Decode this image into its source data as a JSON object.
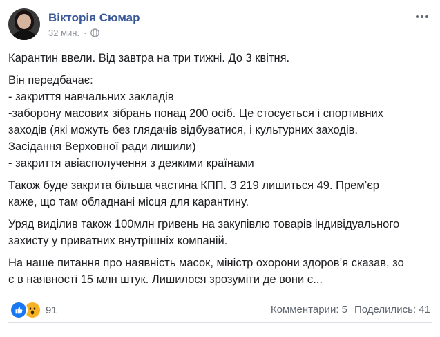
{
  "author": {
    "name": "Вікторія Сюмар",
    "time": "32 мин."
  },
  "icons": {
    "avatar": "avatar-photo",
    "privacy": "globe-icon",
    "more": "more-options-icon",
    "like": "like-reaction-icon",
    "wow": "wow-reaction-icon"
  },
  "post": {
    "paragraphs": [
      [
        "Карантин ввели. Від завтра на три тижні. До 3 квітня."
      ],
      [
        "Він передбачає:",
        "- закриття навчальних закладів",
        "-заборону масових зібрань понад 200 осіб. Це стосується і спортивних",
        "заходів (які можуть без глядачів відбуватися, і культурних заходів.",
        "Засідання Верховної ради лишили)",
        "- закриття авіасполучення з деякими країнами"
      ],
      [
        "Також буде закрита більша частина КПП. З 219 лишиться 49. Прем’єр",
        "каже, що там обладнані місця для карантину."
      ],
      [
        "Уряд виділив також 100млн гривень на закупівлю товарів індивідуального",
        "захисту у приватних внутрішніх компаній."
      ],
      [
        "На наше питання про наявність масок, міністр охорони здоров’я сказав, зо",
        "є в наявності 15 млн штук. Лишилося зрозуміти де вони є..."
      ]
    ]
  },
  "footer": {
    "reaction_count": "91",
    "comments": "Комментарии: 5",
    "shares": "Поделились: 41"
  },
  "colors": {
    "name": "#385898",
    "meta": "#90949c",
    "like": "#1877f2",
    "wow": "#f7b125"
  }
}
